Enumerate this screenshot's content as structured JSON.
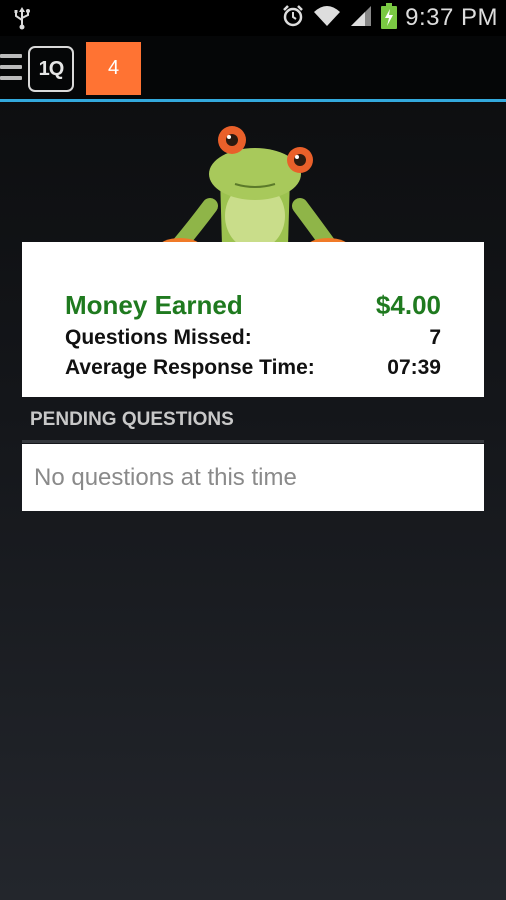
{
  "status_bar": {
    "time": "9:37 PM",
    "icons": [
      "usb-icon",
      "alarm-icon",
      "wifi-icon",
      "signal-icon",
      "battery-charging-icon"
    ]
  },
  "action_bar": {
    "menu_icon": "menu-icon",
    "logo_text": "1Q",
    "badge_count": "4",
    "accent_color": "#33a9dc",
    "badge_color": "#ff7333"
  },
  "stats": {
    "money_label": "Money Earned",
    "money_value": "$4.00",
    "missed_label": "Questions Missed:",
    "missed_value": "7",
    "avg_label": "Average Response Time:",
    "avg_value": "07:39",
    "money_color": "#1f7a1f"
  },
  "pending": {
    "title": "PENDING QUESTIONS",
    "empty_text": "No questions at this time"
  }
}
